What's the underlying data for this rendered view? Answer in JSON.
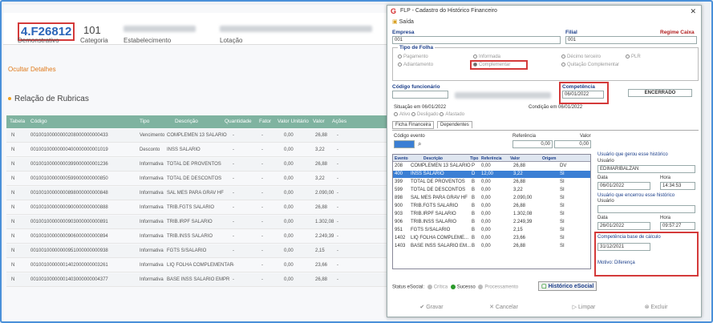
{
  "bg": {
    "code": "4.F26812",
    "code_label": "Demonstrativo",
    "num": "101",
    "num_label": "Categoria",
    "estab_label": "Estabelecimento",
    "lotacao_label": "Lotação",
    "hide": "Ocultar Detalhes",
    "rel_title": "Relação de Rubricas",
    "cols": [
      "Tabela",
      "Código",
      "Tipo",
      "Descrição",
      "Quantidade",
      "Fator",
      "Valor Unitário",
      "Valor",
      "Ações"
    ],
    "rows": [
      [
        "N",
        "00100100000000208000000000433",
        "Vencimento",
        "COMPLEMEN 13 SALARIO",
        "-",
        "-",
        "0,00",
        "26,88",
        "-"
      ],
      [
        "N",
        "00100100000000400000000001019",
        "Desconto",
        "INSS SALARIO",
        "-",
        "-",
        "0,00",
        "3,22",
        "-"
      ],
      [
        "N",
        "00100100000000399000000001236",
        "Informativa",
        "TOTAL DE PROVENTOS",
        "-",
        "-",
        "0,00",
        "26,88",
        "-"
      ],
      [
        "N",
        "00100100000000599000000000850",
        "Informativa",
        "TOTAL DE DESCONTOS",
        "-",
        "-",
        "0,00",
        "3,22",
        "-"
      ],
      [
        "N",
        "00100100000000898000000000848",
        "Informativa",
        "SAL MES PARA GRAV HF",
        "-",
        "-",
        "0,00",
        "2.090,00",
        "-"
      ],
      [
        "N",
        "00100100000000900000000000888",
        "Informativa",
        "TRIB.FGTS SALARIO",
        "-",
        "-",
        "0,00",
        "26,88",
        "-"
      ],
      [
        "N",
        "00100100000000903000000000891",
        "Informativa",
        "TRIB.IRPF SALARIO",
        "-",
        "-",
        "0,00",
        "1.302,08",
        "-"
      ],
      [
        "N",
        "00100100000000906000000000894",
        "Informativa",
        "TRIB.INSS SALARIO",
        "-",
        "-",
        "0,00",
        "2.249,39",
        "-"
      ],
      [
        "N",
        "00100100000000951000000000938",
        "Informativa",
        "FGTS S/SALARIO",
        "-",
        "-",
        "0,00",
        "2,15",
        "-"
      ],
      [
        "N",
        "00100100000001402000000003261",
        "Informativa",
        "LIQ FOLHA COMPLEMENTAR",
        "-",
        "-",
        "0,00",
        "23,66",
        "-"
      ],
      [
        "N",
        "00100100000001403000000004377",
        "Informativa",
        "BASE INSS SALARIO EMPR",
        "-",
        "-",
        "0,00",
        "26,88",
        "-"
      ]
    ]
  },
  "dlg": {
    "title": "FLP - Cadastro do Histórico Financeiro",
    "saida": "Saída",
    "empresa_label": "Empresa",
    "empresa_val": "001",
    "filial_label": "Filial",
    "filial_val": "001",
    "regime_label": "Regime Caixa",
    "tipo_label": "Tipo de Folha",
    "radios": [
      "Pagamento",
      "Informada",
      "Décimo terceiro",
      "PLR",
      "Adiantamento",
      "Complementar",
      "Quitação Complementar"
    ],
    "codfunc_label": "Código funcionário",
    "comp_label": "Competência",
    "comp_val": "06/01/2022",
    "encerrado": "ENCERRADO",
    "situacao": "Situação em 06/01/2022",
    "condicao": "Condição em 06/01/2022",
    "sit_radios": [
      "Ativo",
      "Desligado",
      "Afastado"
    ],
    "tab1": "Ficha Financeira",
    "tab2": "Dependentes",
    "cod_evento": "Código evento",
    "referencia": "Referência",
    "valor": "Valor",
    "ref_val": "0,00",
    "val_val": "0,00",
    "gcols": [
      "Evento",
      "Descrição",
      "Tipo",
      "Referência",
      "Valor",
      "Origem"
    ],
    "grows": [
      [
        "208",
        "COMPLEMEN 13 SALARIO",
        "P",
        "0,00",
        "26,88",
        "DV"
      ],
      [
        "400",
        "INSS SALARIO",
        "D",
        "12,00",
        "3,22",
        "SI"
      ],
      [
        "399",
        "TOTAL DE PROVENTOS",
        "B",
        "0,00",
        "26,88",
        "SI"
      ],
      [
        "599",
        "TOTAL DE DESCONTOS",
        "B",
        "0,00",
        "3,22",
        "SI"
      ],
      [
        "898",
        "SAL MES PARA GRAV HF",
        "B",
        "0,00",
        "2.090,00",
        "SI"
      ],
      [
        "900",
        "TRIB.FGTS SALARIO",
        "B",
        "0,00",
        "26,88",
        "SI"
      ],
      [
        "903",
        "TRIB.IRPF SALARIO",
        "B",
        "0,00",
        "1.302,08",
        "SI"
      ],
      [
        "906",
        "TRIB.INSS SALARIO",
        "B",
        "0,00",
        "2.249,39",
        "SI"
      ],
      [
        "951",
        "FGTS S/SALARIO",
        "B",
        "0,00",
        "2,15",
        "SI"
      ],
      [
        "1402",
        "LIQ FOLHA COMPLEME...",
        "B",
        "0,00",
        "23,66",
        "SI"
      ],
      [
        "1403",
        "BASE INSS SALARIO EM...",
        "B",
        "0,00",
        "26,88",
        "SI"
      ]
    ],
    "user_gerou": "Usuário que gerou esse histórico",
    "usuario": "Usuário",
    "user_val": "EDIMARIBALZAN",
    "data": "Data",
    "hora": "Hora",
    "data1": "06/01/2022",
    "hora1": "14:34:53",
    "user_encerrou": "Usuário que encerrou esse histórico",
    "data2": "26/01/2022",
    "hora2": "09:57:27",
    "comp_base": "Competência base de cálculo",
    "comp_base_val": "31/12/2021",
    "motivo": "Motivo: Diferença",
    "status_label": "Status eSocial:",
    "st_critica": "Crítica",
    "st_sucesso": "Sucesso",
    "st_proc": "Processamento",
    "hist_btn": "Histórico eSocial",
    "btn_gravar": "Gravar",
    "btn_cancelar": "Cancelar",
    "btn_limpar": "Limpar",
    "btn_excluir": "Excluir"
  }
}
